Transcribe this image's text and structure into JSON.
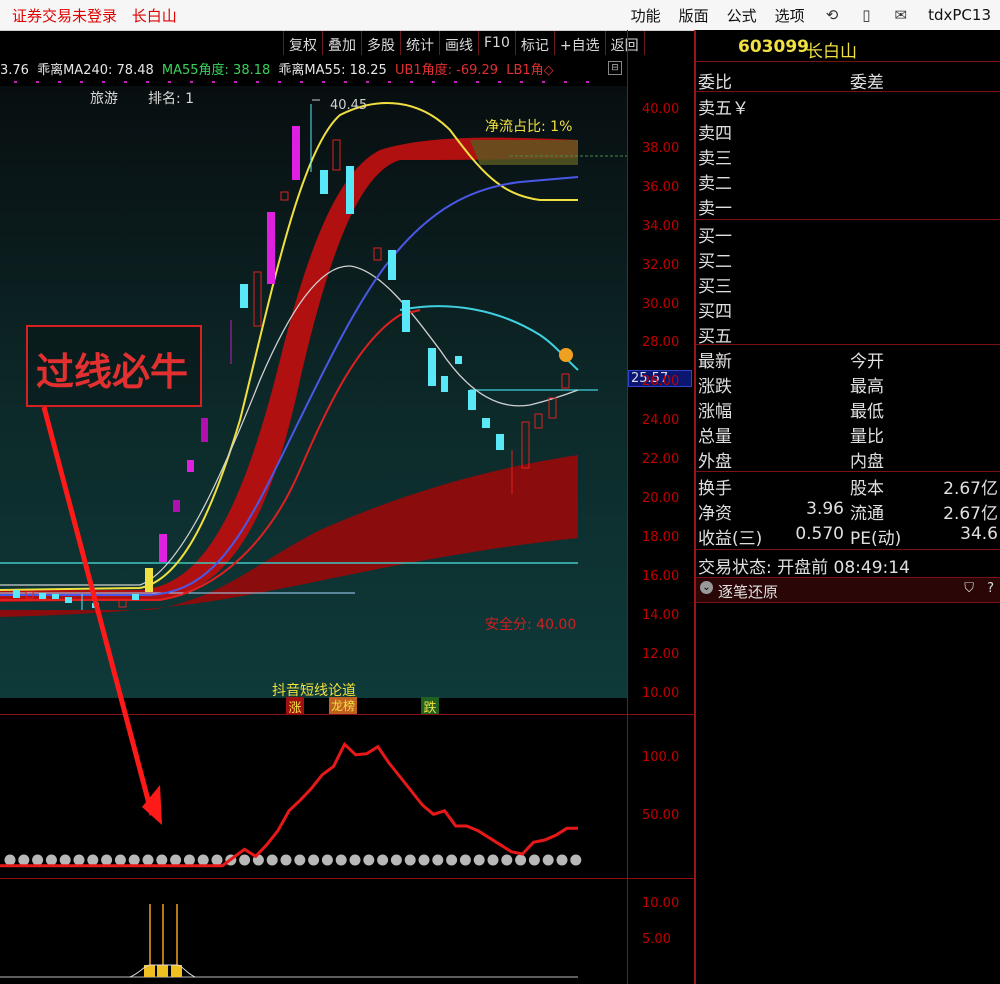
{
  "title_bar": {
    "left_items": [
      "证券交易未登录",
      "长白山"
    ],
    "menus": [
      "功能",
      "版面",
      "公式",
      "选项"
    ],
    "icons": [
      "refresh-icon",
      "phone-icon",
      "mail-icon"
    ],
    "right_label": "tdxPC13"
  },
  "toolbar": {
    "buttons": [
      "复权",
      "叠加",
      "多股",
      "统计",
      "画线",
      "F10",
      "标记",
      "+自选",
      "返回"
    ]
  },
  "ma_line": {
    "items": [
      {
        "text": "3.76",
        "color": "#e6e6e6"
      },
      {
        "text": "乖离MA240: 78.48",
        "color": "#e6e6e6"
      },
      {
        "text": "MA55角度: 38.18",
        "color": "#3ad25a"
      },
      {
        "text": "乖离MA55: 18.25",
        "color": "#e6e6e6"
      },
      {
        "text": "UB1角度: -69.29",
        "color": "#e03030"
      },
      {
        "text": "LB1角◇",
        "color": "#e03030"
      }
    ]
  },
  "info": {
    "sector": "旅游",
    "rank_label": "排名: 1",
    "net_flow": "净流占比: 1%",
    "peak_label": "40.45",
    "safe_score": "安全分: 40.00",
    "current_price": "25.57"
  },
  "annotation": {
    "text": "过线必牛"
  },
  "bottom_tags": {
    "title": "抖音短线论道",
    "zhang": "涨",
    "longhu": "龙榜",
    "die": "跌"
  },
  "main_axis": [
    "40.00",
    "38.00",
    "36.00",
    "34.00",
    "32.00",
    "30.00",
    "28.00",
    "26.00",
    "24.00",
    "22.00",
    "20.00",
    "18.00",
    "16.00",
    "14.00",
    "12.00",
    "10.00"
  ],
  "sub1_axis": [
    "100.0",
    "50.00"
  ],
  "sub2_axis": [
    "10.00",
    "5.00"
  ],
  "colors": {
    "up": "#e02020",
    "down": "#58e8f8",
    "magenta": "#e020e0",
    "yellow_line": "#f0e040",
    "blue_line": "#4050e0",
    "cyan_line": "#40d0e0"
  },
  "chart_data": {
    "type": "candlestick",
    "series": [
      {
        "name": "",
        "values": []
      }
    ],
    "ylim": [
      10,
      41
    ],
    "indicator_ylim": [
      0,
      120
    ],
    "indicator_values": [
      8,
      8,
      8,
      8,
      8,
      8,
      8,
      8,
      8,
      8,
      8,
      8,
      8,
      8,
      8,
      8,
      8,
      8,
      8,
      8,
      8,
      15,
      22,
      16,
      26,
      38,
      55,
      64,
      74,
      86,
      93,
      112,
      103,
      104,
      110,
      96,
      84,
      72,
      60,
      52,
      55,
      42,
      42,
      38,
      32,
      26,
      20,
      18,
      28,
      30,
      34,
      40,
      40
    ],
    "volume_bars": [
      14,
      14,
      14
    ]
  },
  "right_panel": {
    "code": "603099",
    "name": "长白山",
    "weibi": "委比",
    "weicha": "委差",
    "sell": [
      "卖五￥",
      "卖四",
      "卖三",
      "卖二",
      "卖一"
    ],
    "buy": [
      "买一",
      "买二",
      "买三",
      "买四",
      "买五"
    ],
    "q1": [
      [
        "最新",
        "今开"
      ],
      [
        "涨跌",
        "最高"
      ],
      [
        "涨幅",
        "最低"
      ],
      [
        "总量",
        "量比"
      ],
      [
        "外盘",
        "内盘"
      ]
    ],
    "q2": [
      {
        "l": "换手",
        "v1": "",
        "m": "股本",
        "v2": "2.67亿"
      },
      {
        "l": "净资",
        "v1": "3.96",
        "m": "流通",
        "v2": "2.67亿"
      },
      {
        "l": "收益(三)",
        "v1": "0.570",
        "m": "PE(动)",
        "v2": "34.6"
      }
    ],
    "status": "交易状态: 开盘前 08:49:14",
    "tick_title": "逐笔还原",
    "tick_icons": [
      "filter-icon",
      "help-icon"
    ]
  }
}
